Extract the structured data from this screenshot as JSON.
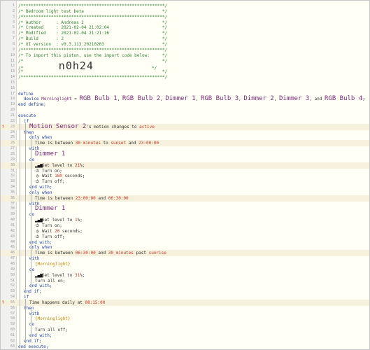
{
  "lines": [
    {
      "n": "1",
      "ind": 0,
      "tokens": [
        {
          "t": "/*********************************************************/",
          "c": "cm"
        }
      ]
    },
    {
      "n": "2",
      "ind": 0,
      "tokens": [
        {
          "t": "/* Bedroom light test beta                               */",
          "c": "cm"
        }
      ]
    },
    {
      "n": "3",
      "ind": 0,
      "tokens": [
        {
          "t": "/*********************************************************/",
          "c": "cm"
        }
      ]
    },
    {
      "n": "4",
      "ind": 0,
      "tokens": [
        {
          "t": "/* Author      : Andreas 2                               */",
          "c": "cm"
        }
      ]
    },
    {
      "n": "5",
      "ind": 0,
      "tokens": [
        {
          "t": "/* Created     : 2021-02-04 21:02:04                     */",
          "c": "cm"
        }
      ]
    },
    {
      "n": "6",
      "ind": 0,
      "tokens": [
        {
          "t": "/* Modified    : 2021-02-04 21:21:16                     */",
          "c": "cm"
        }
      ]
    },
    {
      "n": "7",
      "ind": 0,
      "tokens": [
        {
          "t": "/* Build       : 2                                       */",
          "c": "cm"
        }
      ]
    },
    {
      "n": "8",
      "ind": 0,
      "tokens": [
        {
          "t": "/* UI version  : v0.3.113.20210203                       */",
          "c": "cm"
        }
      ]
    },
    {
      "n": "9",
      "ind": 0,
      "tokens": [
        {
          "t": "/*********************************************************/",
          "c": "cm"
        }
      ]
    },
    {
      "n": "10",
      "ind": 0,
      "tokens": [
        {
          "t": "/* To import this piston, use the import code below:     */",
          "c": "cm"
        }
      ]
    },
    {
      "n": "11",
      "ind": 0,
      "tokens": [
        {
          "t": "/*                                                       */",
          "c": "cm"
        }
      ]
    },
    {
      "n": "12",
      "ind": 0,
      "tokens": [
        {
          "t": "/*              ",
          "c": "cm"
        },
        {
          "t": "n0h24",
          "c": "big"
        },
        {
          "t": "                       */",
          "c": "cm"
        }
      ]
    },
    {
      "n": "13",
      "ind": 0,
      "tokens": [
        {
          "t": "/*                                                       */",
          "c": "cm"
        }
      ]
    },
    {
      "n": "14",
      "ind": 0,
      "tokens": [
        {
          "t": "/*********************************************************/",
          "c": "cm"
        }
      ]
    },
    {
      "n": "15",
      "ind": 0,
      "tokens": [
        {
          "t": "",
          "c": "st"
        }
      ]
    },
    {
      "n": "16",
      "ind": 0,
      "tokens": [
        {
          "t": "",
          "c": "st"
        }
      ]
    },
    {
      "n": "17",
      "ind": 0,
      "tokens": [
        {
          "t": "define",
          "c": "kw"
        }
      ]
    },
    {
      "n": "18",
      "ind": 1,
      "tokens": [
        {
          "t": "device ",
          "c": "kw"
        },
        {
          "t": "Morninglight",
          "c": "dv"
        },
        {
          "t": " = ",
          "c": "st"
        },
        {
          "t": "RGB Bulb 1",
          "c": "dvb"
        },
        {
          "t": ", ",
          "c": "st"
        },
        {
          "t": "RGB Bulb 2",
          "c": "dvb"
        },
        {
          "t": ", ",
          "c": "st"
        },
        {
          "t": "Dimmer 1",
          "c": "dvb"
        },
        {
          "t": ", ",
          "c": "st"
        },
        {
          "t": "RGB Bulb 3",
          "c": "dvb"
        },
        {
          "t": ", ",
          "c": "st"
        },
        {
          "t": "Dimmer 2",
          "c": "dvb"
        },
        {
          "t": ", ",
          "c": "st"
        },
        {
          "t": "Dimmer 3",
          "c": "dvb"
        },
        {
          "t": ", and ",
          "c": "st"
        },
        {
          "t": "RGB Bulb 4",
          "c": "dvb"
        },
        {
          "t": ";",
          "c": "st"
        }
      ]
    },
    {
      "n": "19",
      "ind": 0,
      "tokens": [
        {
          "t": "end define;",
          "c": "kw"
        }
      ]
    },
    {
      "n": "20",
      "ind": 0,
      "tokens": [
        {
          "t": "",
          "c": "st"
        }
      ]
    },
    {
      "n": "21",
      "ind": 0,
      "tokens": [
        {
          "t": "execute",
          "c": "kw"
        }
      ]
    },
    {
      "n": "22",
      "ind": 1,
      "tokens": [
        {
          "t": "if",
          "c": "kw"
        }
      ]
    },
    {
      "n": "23",
      "ind": 2,
      "mk": "s",
      "tokens": [
        {
          "t": "Motion Sensor 2",
          "c": "dvb"
        },
        {
          "t": "'s motion changes to ",
          "c": "st"
        },
        {
          "t": "active",
          "c": "nm"
        }
      ]
    },
    {
      "n": "24",
      "ind": 1,
      "tokens": [
        {
          "t": "then",
          "c": "kw"
        }
      ]
    },
    {
      "n": "25",
      "ind": 2,
      "tokens": [
        {
          "t": "only when",
          "c": "kw"
        }
      ]
    },
    {
      "n": "26",
      "ind": 3,
      "tokens": [
        {
          "t": "Time is between ",
          "c": "st"
        },
        {
          "t": "30",
          "c": "nm"
        },
        {
          "t": " minutes",
          "c": "nm"
        },
        {
          "t": " to ",
          "c": "st"
        },
        {
          "t": "sunset",
          "c": "nm"
        },
        {
          "t": " and ",
          "c": "st"
        },
        {
          "t": "23:00:00",
          "c": "nm"
        }
      ]
    },
    {
      "n": "27",
      "ind": 2,
      "tokens": [
        {
          "t": "with",
          "c": "kw"
        }
      ]
    },
    {
      "n": "28",
      "ind": 3,
      "tokens": [
        {
          "t": "Dimmer 1",
          "c": "dvb"
        }
      ]
    },
    {
      "n": "29",
      "ind": 2,
      "tokens": [
        {
          "t": "do",
          "c": "kw"
        }
      ]
    },
    {
      "n": "30",
      "ind": 3,
      "icon": "signal",
      "tokens": [
        {
          "t": "Set level to ",
          "c": "st"
        },
        {
          "t": "21",
          "c": "nm"
        },
        {
          "t": "%;",
          "c": "st"
        }
      ]
    },
    {
      "n": "31",
      "ind": 3,
      "icon": "power",
      "tokens": [
        {
          "t": "Turn on;",
          "c": "st"
        }
      ]
    },
    {
      "n": "32",
      "ind": 3,
      "icon": "clock",
      "tokens": [
        {
          "t": "Wait ",
          "c": "st"
        },
        {
          "t": "180",
          "c": "nm"
        },
        {
          "t": " seconds;",
          "c": "st"
        }
      ]
    },
    {
      "n": "33",
      "ind": 3,
      "icon": "power",
      "tokens": [
        {
          "t": "Turn off;",
          "c": "st"
        }
      ]
    },
    {
      "n": "34",
      "ind": 2,
      "tokens": [
        {
          "t": "end with;",
          "c": "kw"
        }
      ]
    },
    {
      "n": "35",
      "ind": 2,
      "tokens": [
        {
          "t": "only when",
          "c": "kw"
        }
      ]
    },
    {
      "n": "36",
      "ind": 3,
      "tokens": [
        {
          "t": "Time is between ",
          "c": "st"
        },
        {
          "t": "23:00:00",
          "c": "nm"
        },
        {
          "t": " and ",
          "c": "st"
        },
        {
          "t": "06:30:00",
          "c": "nm"
        }
      ]
    },
    {
      "n": "37",
      "ind": 2,
      "tokens": [
        {
          "t": "with",
          "c": "kw"
        }
      ]
    },
    {
      "n": "38",
      "ind": 3,
      "tokens": [
        {
          "t": "Dimmer 1",
          "c": "dvb"
        }
      ]
    },
    {
      "n": "39",
      "ind": 2,
      "tokens": [
        {
          "t": "do",
          "c": "kw"
        }
      ]
    },
    {
      "n": "40",
      "ind": 3,
      "icon": "signal",
      "tokens": [
        {
          "t": "Set level to ",
          "c": "st"
        },
        {
          "t": "1",
          "c": "nm"
        },
        {
          "t": "%;",
          "c": "st"
        }
      ]
    },
    {
      "n": "41",
      "ind": 3,
      "icon": "power",
      "tokens": [
        {
          "t": "Turn on;",
          "c": "st"
        }
      ]
    },
    {
      "n": "42",
      "ind": 3,
      "icon": "clock",
      "tokens": [
        {
          "t": "Wait ",
          "c": "st"
        },
        {
          "t": "20",
          "c": "nm"
        },
        {
          "t": " seconds;",
          "c": "st"
        }
      ]
    },
    {
      "n": "43",
      "ind": 3,
      "icon": "power",
      "tokens": [
        {
          "t": "Turn off;",
          "c": "st"
        }
      ]
    },
    {
      "n": "44",
      "ind": 2,
      "tokens": [
        {
          "t": "end with;",
          "c": "kw"
        }
      ]
    },
    {
      "n": "45",
      "ind": 2,
      "tokens": [
        {
          "t": "only when",
          "c": "kw"
        }
      ]
    },
    {
      "n": "46",
      "ind": 3,
      "tokens": [
        {
          "t": "Time is between ",
          "c": "st"
        },
        {
          "t": "06:30:00",
          "c": "nm"
        },
        {
          "t": " and ",
          "c": "st"
        },
        {
          "t": "30",
          "c": "nm"
        },
        {
          "t": " minutes",
          "c": "nm"
        },
        {
          "t": " past ",
          "c": "st"
        },
        {
          "t": "sunrise",
          "c": "nm"
        }
      ]
    },
    {
      "n": "47",
      "ind": 2,
      "tokens": [
        {
          "t": "with",
          "c": "kw"
        }
      ]
    },
    {
      "n": "48",
      "ind": 3,
      "tokens": [
        {
          "t": "{Morninglight}",
          "c": "vr"
        }
      ]
    },
    {
      "n": "49",
      "ind": 2,
      "tokens": [
        {
          "t": "do",
          "c": "kw"
        }
      ]
    },
    {
      "n": "50",
      "ind": 3,
      "icon": "signal",
      "tokens": [
        {
          "t": "Set level to ",
          "c": "st"
        },
        {
          "t": "31",
          "c": "nm"
        },
        {
          "t": "%;",
          "c": "st"
        }
      ]
    },
    {
      "n": "51",
      "ind": 3,
      "tokens": [
        {
          "t": "Turn all on;",
          "c": "st"
        }
      ]
    },
    {
      "n": "52",
      "ind": 2,
      "tokens": [
        {
          "t": "end with;",
          "c": "kw"
        }
      ]
    },
    {
      "n": "53",
      "ind": 1,
      "tokens": [
        {
          "t": "end if;",
          "c": "kw"
        }
      ]
    },
    {
      "n": "54",
      "ind": 1,
      "tokens": [
        {
          "t": "if",
          "c": "kw"
        }
      ]
    },
    {
      "n": "55",
      "ind": 2,
      "mk": "s",
      "tokens": [
        {
          "t": "Time happens daily at ",
          "c": "st"
        },
        {
          "t": "08:15:00",
          "c": "nm"
        }
      ]
    },
    {
      "n": "56",
      "ind": 1,
      "tokens": [
        {
          "t": "then",
          "c": "kw"
        }
      ]
    },
    {
      "n": "57",
      "ind": 2,
      "tokens": [
        {
          "t": "with",
          "c": "kw"
        }
      ]
    },
    {
      "n": "58",
      "ind": 3,
      "tokens": [
        {
          "t": "{Morninglight}",
          "c": "vr"
        }
      ]
    },
    {
      "n": "59",
      "ind": 2,
      "tokens": [
        {
          "t": "do",
          "c": "kw"
        }
      ]
    },
    {
      "n": "60",
      "ind": 3,
      "tokens": [
        {
          "t": "Turn all off;",
          "c": "st"
        }
      ]
    },
    {
      "n": "61",
      "ind": 2,
      "tokens": [
        {
          "t": "end with;",
          "c": "kw"
        }
      ]
    },
    {
      "n": "62",
      "ind": 1,
      "tokens": [
        {
          "t": "end if;",
          "c": "kw"
        }
      ]
    },
    {
      "n": "63",
      "ind": 0,
      "tokens": [
        {
          "t": "end execute;",
          "c": "kw"
        }
      ]
    }
  ],
  "markers": {
    "s": "§"
  },
  "icons": {
    "signal": "signal-bars-icon",
    "power": "power-icon",
    "clock": "clock-icon"
  },
  "icon_glyphs": {
    "signal": "▂▄▆",
    "power": "⏻",
    "clock": "◷"
  }
}
